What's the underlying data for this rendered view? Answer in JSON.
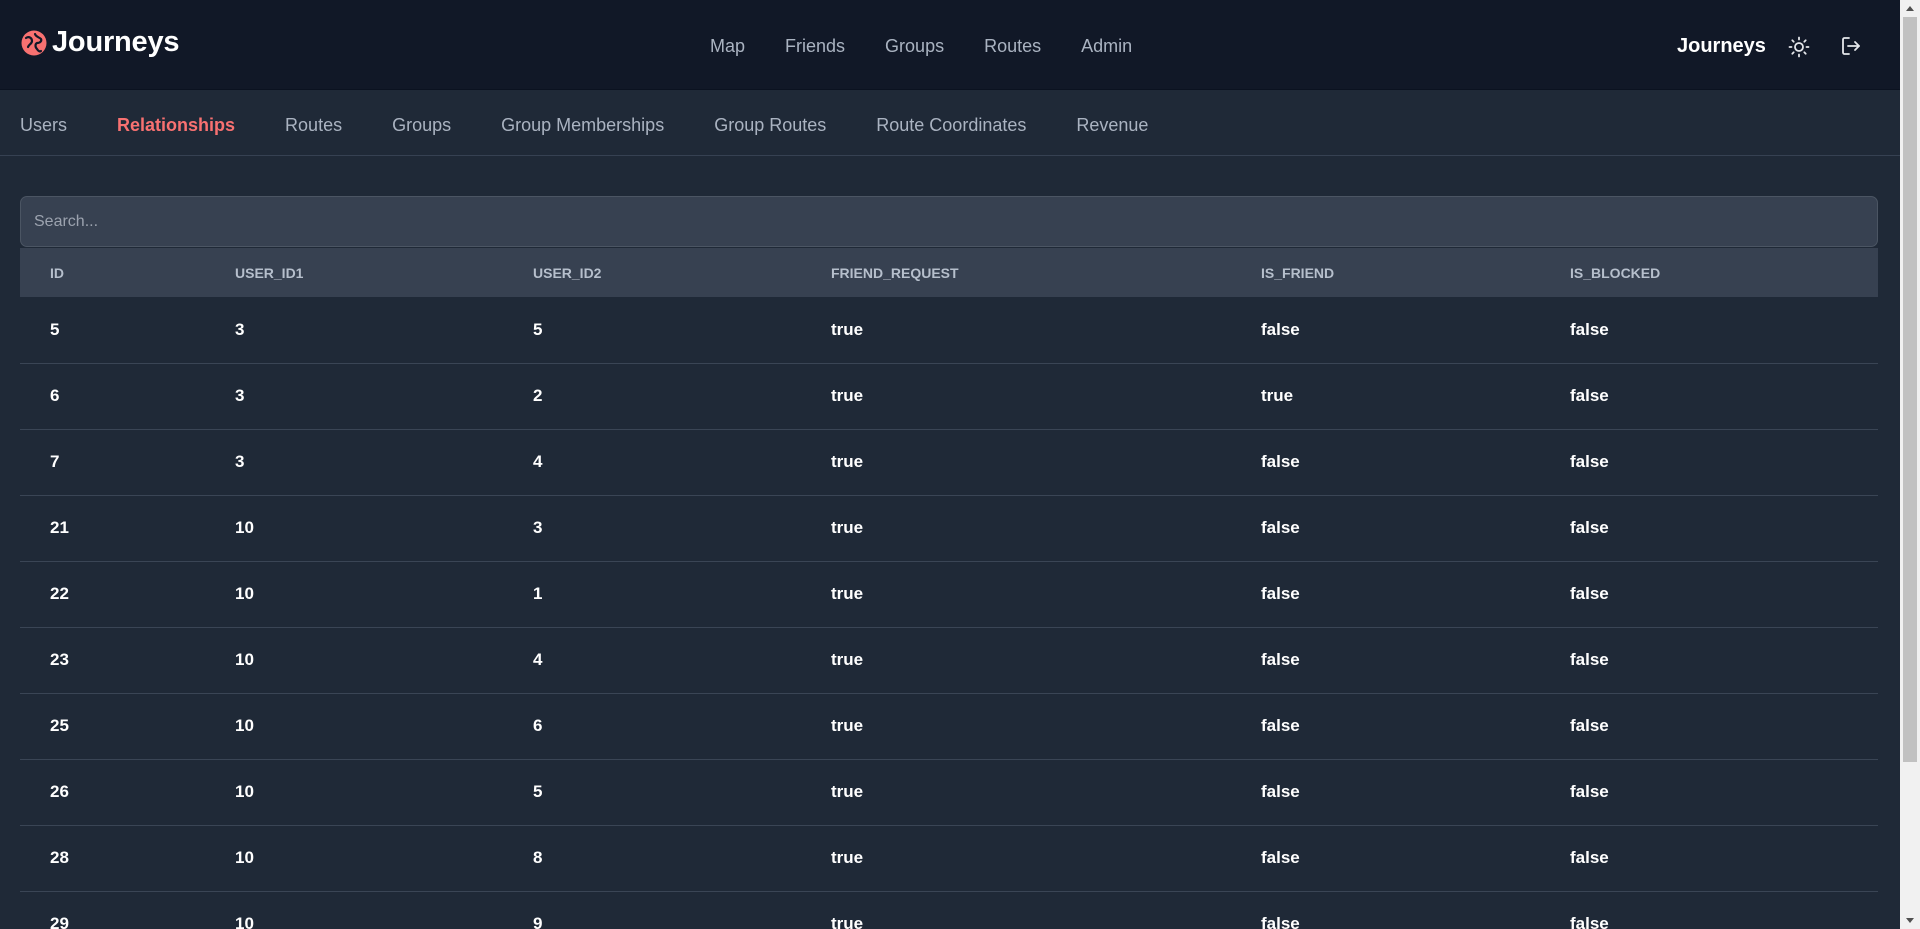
{
  "brand": {
    "name": "Journeys",
    "logo_icon": "globe-icon",
    "accent_color": "#f87171"
  },
  "main_nav": [
    {
      "label": "Map"
    },
    {
      "label": "Friends"
    },
    {
      "label": "Groups"
    },
    {
      "label": "Routes"
    },
    {
      "label": "Admin"
    }
  ],
  "user": {
    "name": "Journeys"
  },
  "header_icons": {
    "theme": "sun-icon",
    "logout": "logout-icon"
  },
  "sub_nav": {
    "active": "Relationships",
    "items": [
      {
        "label": "Users"
      },
      {
        "label": "Relationships"
      },
      {
        "label": "Routes"
      },
      {
        "label": "Groups"
      },
      {
        "label": "Group Memberships"
      },
      {
        "label": "Group Routes"
      },
      {
        "label": "Route Coordinates"
      },
      {
        "label": "Revenue"
      }
    ]
  },
  "search": {
    "placeholder": "Search...",
    "value": ""
  },
  "table": {
    "columns": [
      "ID",
      "USER_ID1",
      "USER_ID2",
      "FRIEND_REQUEST",
      "IS_FRIEND",
      "IS_BLOCKED"
    ],
    "rows": [
      [
        "5",
        "3",
        "5",
        "true",
        "false",
        "false"
      ],
      [
        "6",
        "3",
        "2",
        "true",
        "true",
        "false"
      ],
      [
        "7",
        "3",
        "4",
        "true",
        "false",
        "false"
      ],
      [
        "21",
        "10",
        "3",
        "true",
        "false",
        "false"
      ],
      [
        "22",
        "10",
        "1",
        "true",
        "false",
        "false"
      ],
      [
        "23",
        "10",
        "4",
        "true",
        "false",
        "false"
      ],
      [
        "25",
        "10",
        "6",
        "true",
        "false",
        "false"
      ],
      [
        "26",
        "10",
        "5",
        "true",
        "false",
        "false"
      ],
      [
        "28",
        "10",
        "8",
        "true",
        "false",
        "false"
      ],
      [
        "29",
        "10",
        "9",
        "true",
        "false",
        "false"
      ]
    ]
  }
}
